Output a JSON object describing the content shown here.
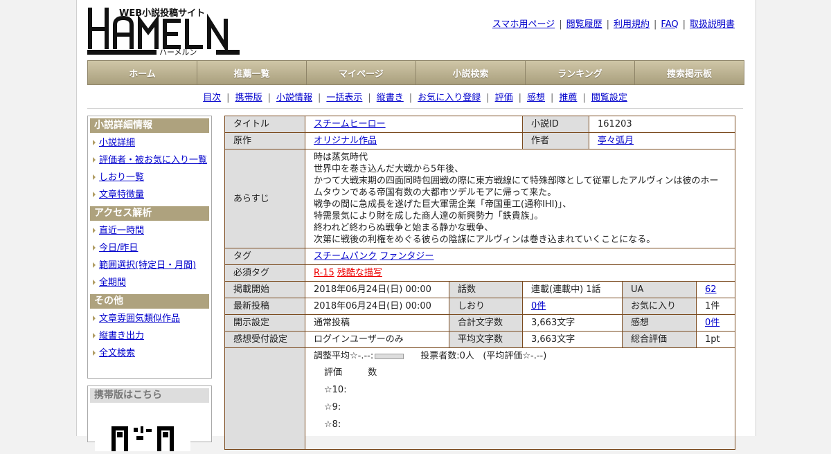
{
  "logo": {
    "main": "HAMELN",
    "tagline": "WEB小説投稿サイト",
    "kana": "ハーメルン"
  },
  "top_links": [
    "スマホ用ページ",
    "閲覧履歴",
    "利用規約",
    "FAQ",
    "取扱説明書"
  ],
  "top_sep": "|",
  "global_nav": [
    "ホーム",
    "推薦一覧",
    "マイページ",
    "小説検索",
    "ランキング",
    "捜索掲示板"
  ],
  "sub_nav": [
    "目次",
    "携帯版",
    "小説情報",
    "一括表示",
    "縦書き",
    "お気に入り登録",
    "評価",
    "感想",
    "推薦",
    "閲覧設定"
  ],
  "sub_sep": "|",
  "sidebar": {
    "sections": [
      {
        "title": "小説詳細情報",
        "items": [
          "小説詳細",
          "評価者・被お気に入り一覧",
          "しおり一覧",
          "文章特徴量"
        ]
      },
      {
        "title": "アクセス解析",
        "items": [
          "直近一時間",
          "今日/昨日",
          "範囲選択(特定日・月間)",
          "全期間"
        ]
      },
      {
        "title": "その他",
        "items": [
          "文章雰囲気類似作品",
          "縦書き出力",
          "全文検索"
        ]
      }
    ],
    "mobile_title": "携帯版はこちら"
  },
  "info": {
    "title_label": "タイトル",
    "title": "スチームヒーロー",
    "id_label": "小説ID",
    "id": "161203",
    "origin_label": "原作",
    "origin": "オリジナル作品",
    "author_label": "作者",
    "author": "亭々弧月",
    "summary_label": "あらすじ",
    "summary": [
      "時は蒸気時代",
      "世界中を巻き込んだ大戦から5年後、",
      "かつて大戦末期の四面同時包囲戦の際に東方戦線にて特殊部隊として従軍したアルヴィンは彼のホームタウンである帝国有数の大都市ツデルモアに帰って来た。",
      "戦争の間に急成長を遂げた巨大軍需企業「帝国重工(通称IHI)」、",
      "特需景気により財を成した商人達の新興勢力「鉄貴族」。",
      "終われど終わらぬ戦争と始まる静かな戦争、",
      "次第に戦後の利権をめぐる彼らの陰謀にアルヴィンは巻き込まれていくことになる。"
    ],
    "tags_label": "タグ",
    "tags": [
      "スチームパンク",
      "ファンタジー"
    ],
    "req_tags_label": "必須タグ",
    "req_tags": [
      "R-15",
      "残酷な描写"
    ],
    "rows": [
      {
        "l1": "掲載開始",
        "v1": "2018年06月24日(日) 00:00",
        "l2": "話数",
        "v2": "連載(連載中) 1話",
        "l3": "UA",
        "v3": "62"
      },
      {
        "l1": "最新投稿",
        "v1": "2018年06月24日(日) 00:00",
        "l2": "しおり",
        "v2": "0件",
        "l3": "お気に入り",
        "v3": "1件"
      },
      {
        "l1": "開示設定",
        "v1": "通常投稿",
        "l2": "合計文字数",
        "v2": "3,663文字",
        "l3": "感想",
        "v3": "0件"
      },
      {
        "l1": "感想受付設定",
        "v1": "ログインユーザーのみ",
        "l2": "平均文字数",
        "v2": "3,663文字",
        "l3": "総合評価",
        "v3": "1pt"
      }
    ],
    "eval": {
      "avg": "調整平均☆-.--:",
      "voters": "投票者数:0人",
      "avg2": "(平均評価☆-.--)",
      "head_rating": "評価",
      "head_count": "数",
      "levels": [
        "☆10:",
        "☆9:",
        "☆8:"
      ]
    }
  }
}
